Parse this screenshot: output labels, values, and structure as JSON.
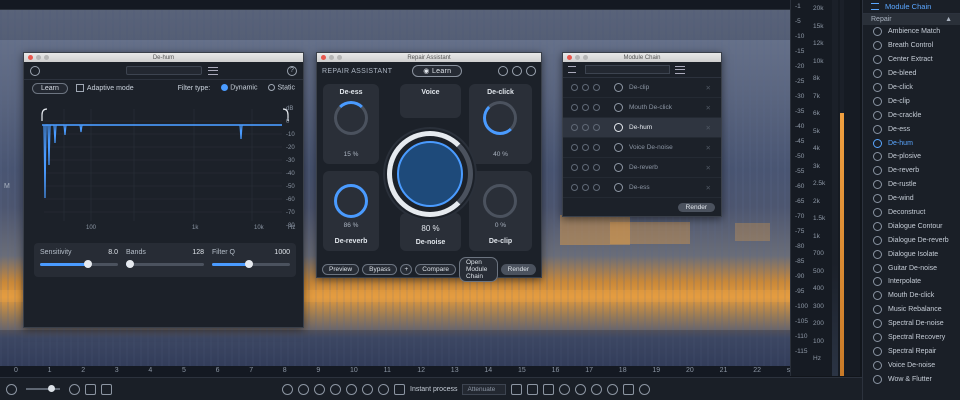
{
  "spectrogram": {
    "bottom_ruler": [
      "0",
      "1",
      "2",
      "3",
      "4",
      "5",
      "6",
      "7",
      "8",
      "9",
      "10",
      "11",
      "12",
      "13",
      "14",
      "15",
      "16",
      "17",
      "18",
      "19",
      "20",
      "21",
      "22",
      "sec"
    ],
    "left_marker": "M"
  },
  "scale": {
    "hz_labels": [
      "20k",
      "15k",
      "12k",
      "10k",
      "8k",
      "7k",
      "6k",
      "5k",
      "4k",
      "3k",
      "2.5k",
      "2k",
      "1.5k",
      "1k",
      "700",
      "500",
      "400",
      "300",
      "200",
      "100",
      "Hz"
    ],
    "db_labels": [
      "-1",
      "-5",
      "-10",
      "-15",
      "-20",
      "-25",
      "-30",
      "-35",
      "-40",
      "-45",
      "-50",
      "-55",
      "-60",
      "-65",
      "-70",
      "-75",
      "-80",
      "-85",
      "-90",
      "-95",
      "-100",
      "-105",
      "-110",
      "-115"
    ]
  },
  "sidebar": {
    "header": "Module Chain",
    "section": "Repair",
    "items": [
      {
        "label": "Ambience Match"
      },
      {
        "label": "Breath Control"
      },
      {
        "label": "Center Extract"
      },
      {
        "label": "De-bleed"
      },
      {
        "label": "De-click"
      },
      {
        "label": "De-clip"
      },
      {
        "label": "De-crackle"
      },
      {
        "label": "De-ess"
      },
      {
        "label": "De-hum",
        "active": true
      },
      {
        "label": "De-plosive"
      },
      {
        "label": "De-reverb"
      },
      {
        "label": "De-rustle"
      },
      {
        "label": "De-wind"
      },
      {
        "label": "Deconstruct"
      },
      {
        "label": "Dialogue Contour"
      },
      {
        "label": "Dialogue De-reverb"
      },
      {
        "label": "Dialogue Isolate"
      },
      {
        "label": "Guitar De-noise"
      },
      {
        "label": "Interpolate"
      },
      {
        "label": "Mouth De-click"
      },
      {
        "label": "Music Rebalance"
      },
      {
        "label": "Spectral De-noise"
      },
      {
        "label": "Spectral Recovery"
      },
      {
        "label": "Spectral Repair"
      },
      {
        "label": "Voice De-noise"
      },
      {
        "label": "Wow & Flutter"
      }
    ]
  },
  "dehum": {
    "title": "De-hum",
    "learn": "Learn",
    "adaptive_mode": "Adaptive mode",
    "filter_type": "Filter type:",
    "dynamic": "Dynamic",
    "static": "Static",
    "db_axis": [
      "dB",
      "0",
      "-10",
      "-20",
      "-30",
      "-40",
      "-50",
      "-60",
      "-70",
      "-80"
    ],
    "freq_axis": [
      "100",
      "1k",
      "10k"
    ],
    "hz": "Hz",
    "sensitivity": {
      "label": "Sensitivity",
      "value": "8.0",
      "fill": 0.62
    },
    "bands": {
      "label": "Bands",
      "value": "128",
      "fill": 0.05
    },
    "filter_q": {
      "label": "Filter Q",
      "value": "1000",
      "fill": 0.47
    }
  },
  "ra": {
    "title": "Repair Assistant",
    "header": "REPAIR ASSISTANT",
    "learn": "Learn",
    "deess": {
      "label": "De-ess",
      "pct": "15 %"
    },
    "voice": {
      "label": "Voice"
    },
    "declick": {
      "label": "De-click",
      "pct": "40 %"
    },
    "dereverb": {
      "label": "De-reverb",
      "pct": "86 %"
    },
    "denoise": {
      "label": "De-noise",
      "pct": "80 %"
    },
    "declip": {
      "label": "De-clip",
      "pct": "0 %"
    },
    "buttons": {
      "preview": "Preview",
      "bypass": "Bypass",
      "plus": "+",
      "compare": "Compare",
      "open_chain": "Open Module Chain",
      "render": "Render"
    }
  },
  "mc": {
    "title": "Module Chain",
    "modules": [
      {
        "label": "De-clip"
      },
      {
        "label": "Mouth De-click"
      },
      {
        "label": "De-hum",
        "active": true
      },
      {
        "label": "Voice De-noise"
      },
      {
        "label": "De-reverb"
      },
      {
        "label": "De-ess"
      }
    ],
    "render": "Render"
  },
  "bottombar": {
    "instant_process": "Instant process",
    "attenuate": "Attenuate"
  },
  "colors": {
    "accent": "#4a9bff",
    "orange": "#e39a3c"
  }
}
